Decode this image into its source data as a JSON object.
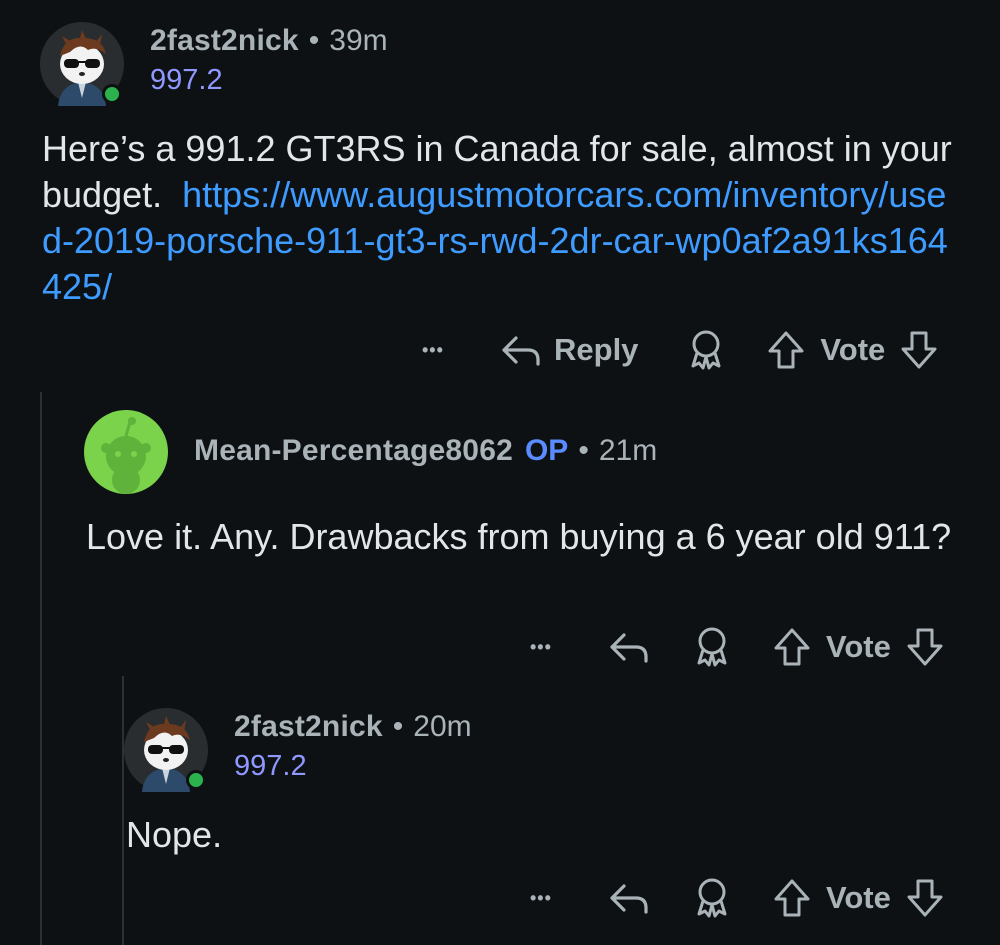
{
  "comments": [
    {
      "username": "2fast2nick",
      "separator": "•",
      "time": "39m",
      "flair": "997.2",
      "body_text": "Here’s a 991.2 GT3RS in Canada for sale, almost in your budget.",
      "body_link": "https://www.augustmotorcars.com/inventory/used-2019-porsche-911-gt3-rs-rwd-2dr-car-wp0af2a91ks164425/",
      "reply_label": "Reply",
      "vote_label": "Vote",
      "more_label": "•••"
    },
    {
      "username": "Mean-Percentage8062",
      "op_badge": "OP",
      "separator": "•",
      "time": "21m",
      "body_text": "Love it. Any. Drawbacks from buying a 6 year old 911?",
      "vote_label": "Vote",
      "more_label": "•••"
    },
    {
      "username": "2fast2nick",
      "separator": "•",
      "time": "20m",
      "flair": "997.2",
      "body_text": "Nope.",
      "vote_label": "Vote",
      "more_label": "•••"
    }
  ],
  "icons": {
    "more": "more-horizontal-icon",
    "reply": "reply-arrow-icon",
    "award": "award-icon",
    "upvote": "upvote-arrow-icon",
    "downvote": "downvote-arrow-icon"
  },
  "colors": {
    "background": "#0e1113",
    "link": "#3e9bff",
    "op": "#5b8cff",
    "flair": "#8f98ff",
    "online": "#2bb24c"
  }
}
